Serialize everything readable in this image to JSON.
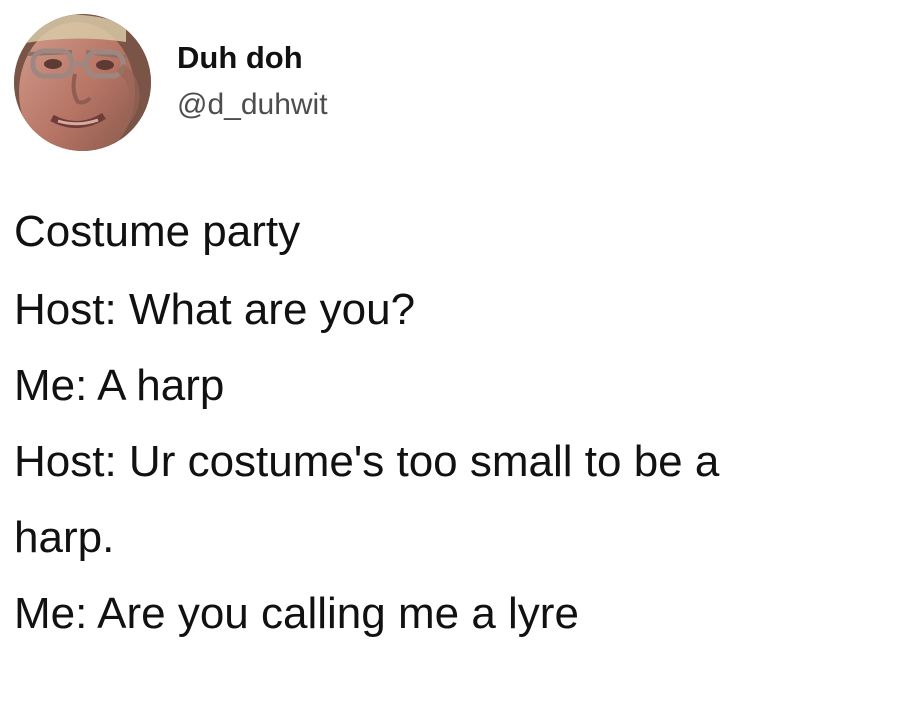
{
  "author": {
    "display_name": "Duh doh",
    "handle": "@d_duhwit",
    "avatar": "profile-photo"
  },
  "tweet": {
    "lines": [
      "Costume party",
      "Host: What are you?",
      "Me: A harp",
      "Host: Ur costume's too small to be a",
      "harp.",
      "Me: Are you calling me a lyre"
    ]
  }
}
